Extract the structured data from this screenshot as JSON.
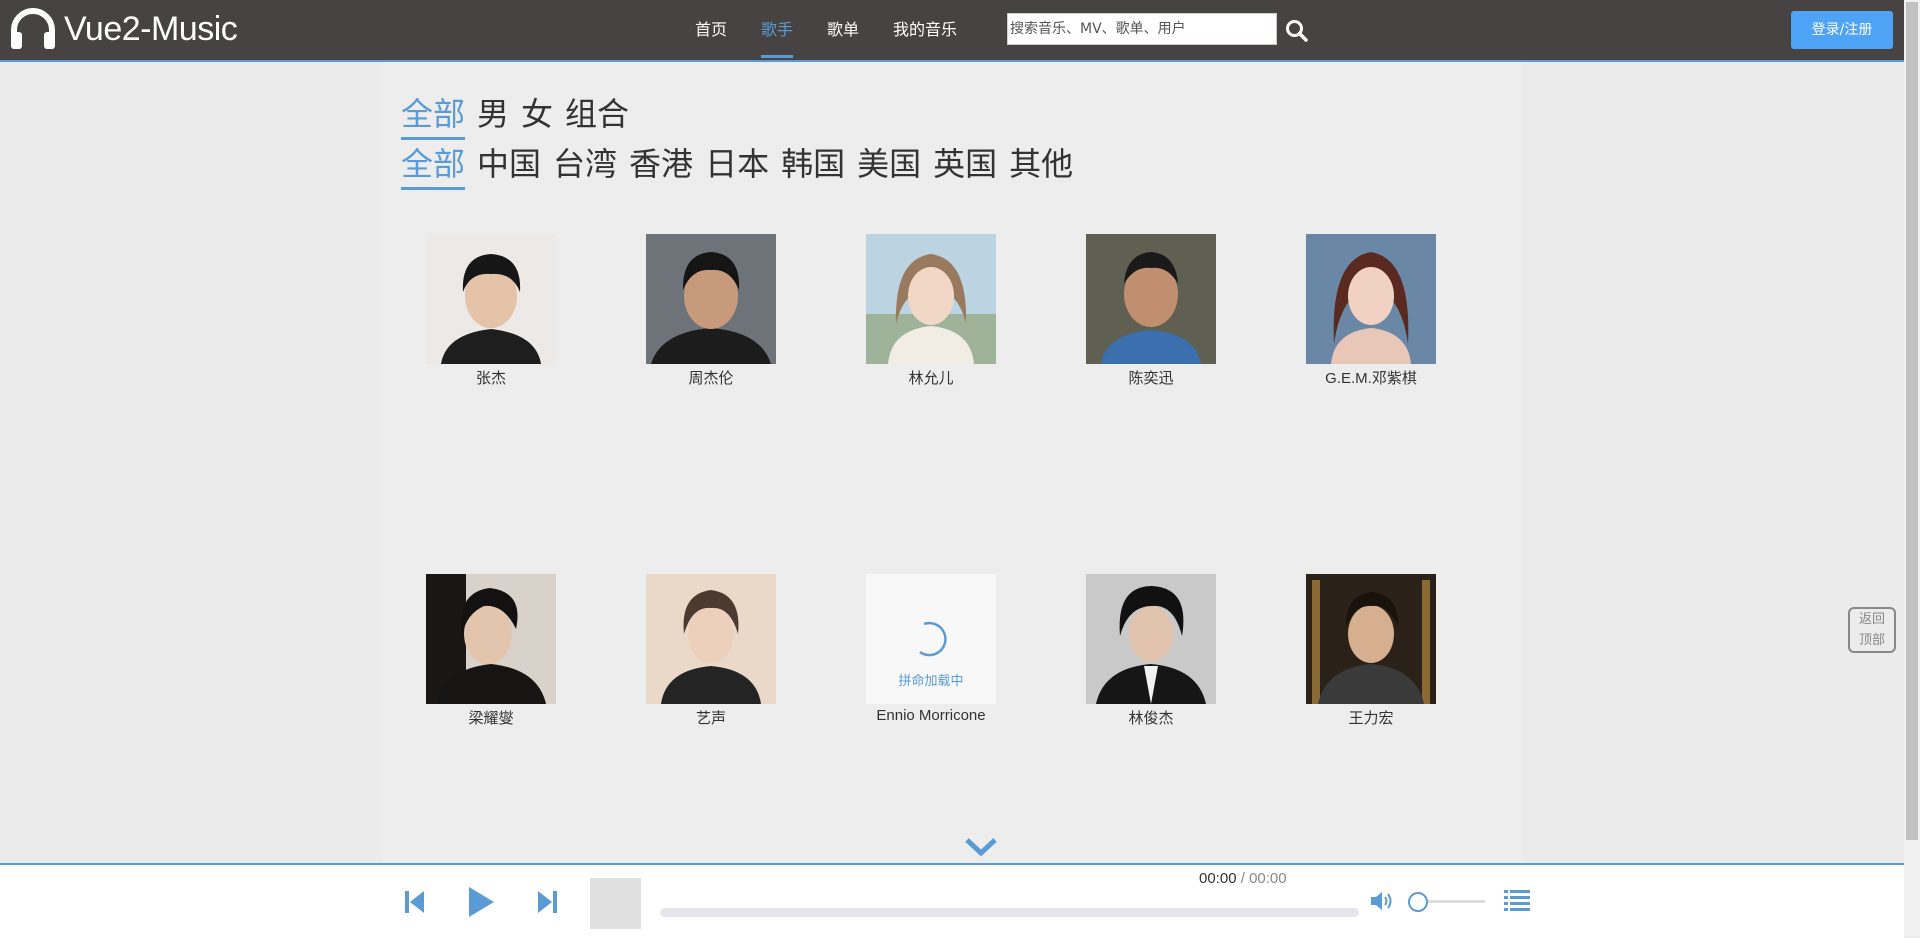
{
  "header": {
    "logo_text": "Vue2-Music",
    "nav": [
      {
        "label": "首页",
        "active": false
      },
      {
        "label": "歌手",
        "active": true
      },
      {
        "label": "歌单",
        "active": false
      },
      {
        "label": "我的音乐",
        "active": false
      }
    ],
    "search_placeholder": "搜索音乐、MV、歌单、用户",
    "login_label": "登录/注册"
  },
  "filters": {
    "gender": [
      "全部",
      "男",
      "女",
      "组合"
    ],
    "region": [
      "全部",
      "中国",
      "台湾",
      "香港",
      "日本",
      "韩国",
      "美国",
      "英国",
      "其他"
    ]
  },
  "artists": [
    {
      "name": "张杰"
    },
    {
      "name": "周杰伦"
    },
    {
      "name": "林允儿"
    },
    {
      "name": "陈奕迅"
    },
    {
      "name": "G.E.M.邓紫棋"
    },
    {
      "name": "梁耀燮"
    },
    {
      "name": "艺声"
    },
    {
      "name": "Ennio Morricone",
      "loading_text": "拼命加载中"
    },
    {
      "name": "林俊杰"
    },
    {
      "name": "王力宏"
    }
  ],
  "back_to_top": {
    "line1": "返回",
    "line2": "顶部"
  },
  "player": {
    "current_time": "00:00",
    "separator": " / ",
    "total_time": "00:00",
    "progress": 0,
    "volume": 0.05
  },
  "colors": {
    "accent": "#5b9bd5",
    "header_bg": "#474342",
    "login_bg": "#4fa3f7"
  },
  "icons": [
    "headphones-icon",
    "search-icon",
    "chevron-down-icon",
    "prev-icon",
    "play-icon",
    "next-icon",
    "volume-icon",
    "playlist-icon",
    "loading-spinner-icon"
  ]
}
